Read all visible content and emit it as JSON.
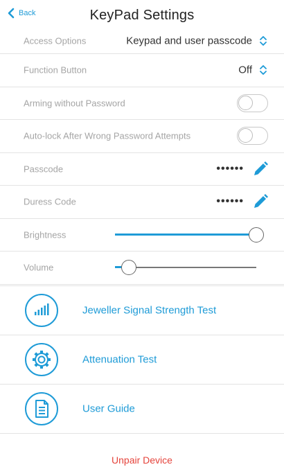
{
  "header": {
    "back_label": "Back",
    "title": "KeyPad Settings"
  },
  "settings": {
    "access_options": {
      "label": "Access Options",
      "value": "Keypad and user passcode"
    },
    "function_button": {
      "label": "Function Button",
      "value": "Off"
    },
    "arming_without_password": {
      "label": "Arming without Password",
      "enabled": false
    },
    "auto_lock": {
      "label": "Auto-lock After Wrong Password Attempts",
      "enabled": false
    },
    "passcode": {
      "label": "Passcode",
      "masked": "••••••"
    },
    "duress_code": {
      "label": "Duress Code",
      "masked": "••••••"
    },
    "brightness": {
      "label": "Brightness",
      "level": 1.0
    },
    "volume": {
      "label": "Volume",
      "level": 0.1
    }
  },
  "actions": [
    {
      "label": "Jeweller Signal Strength Test",
      "icon": "signal-bars-icon"
    },
    {
      "label": "Attenuation Test",
      "icon": "gear-icon"
    },
    {
      "label": "User Guide",
      "icon": "document-icon"
    }
  ],
  "footer": {
    "unpair_label": "Unpair Device"
  },
  "colors": {
    "accent": "#1e9bd7",
    "danger": "#e5433b",
    "muted_label": "#a5a5a5"
  }
}
